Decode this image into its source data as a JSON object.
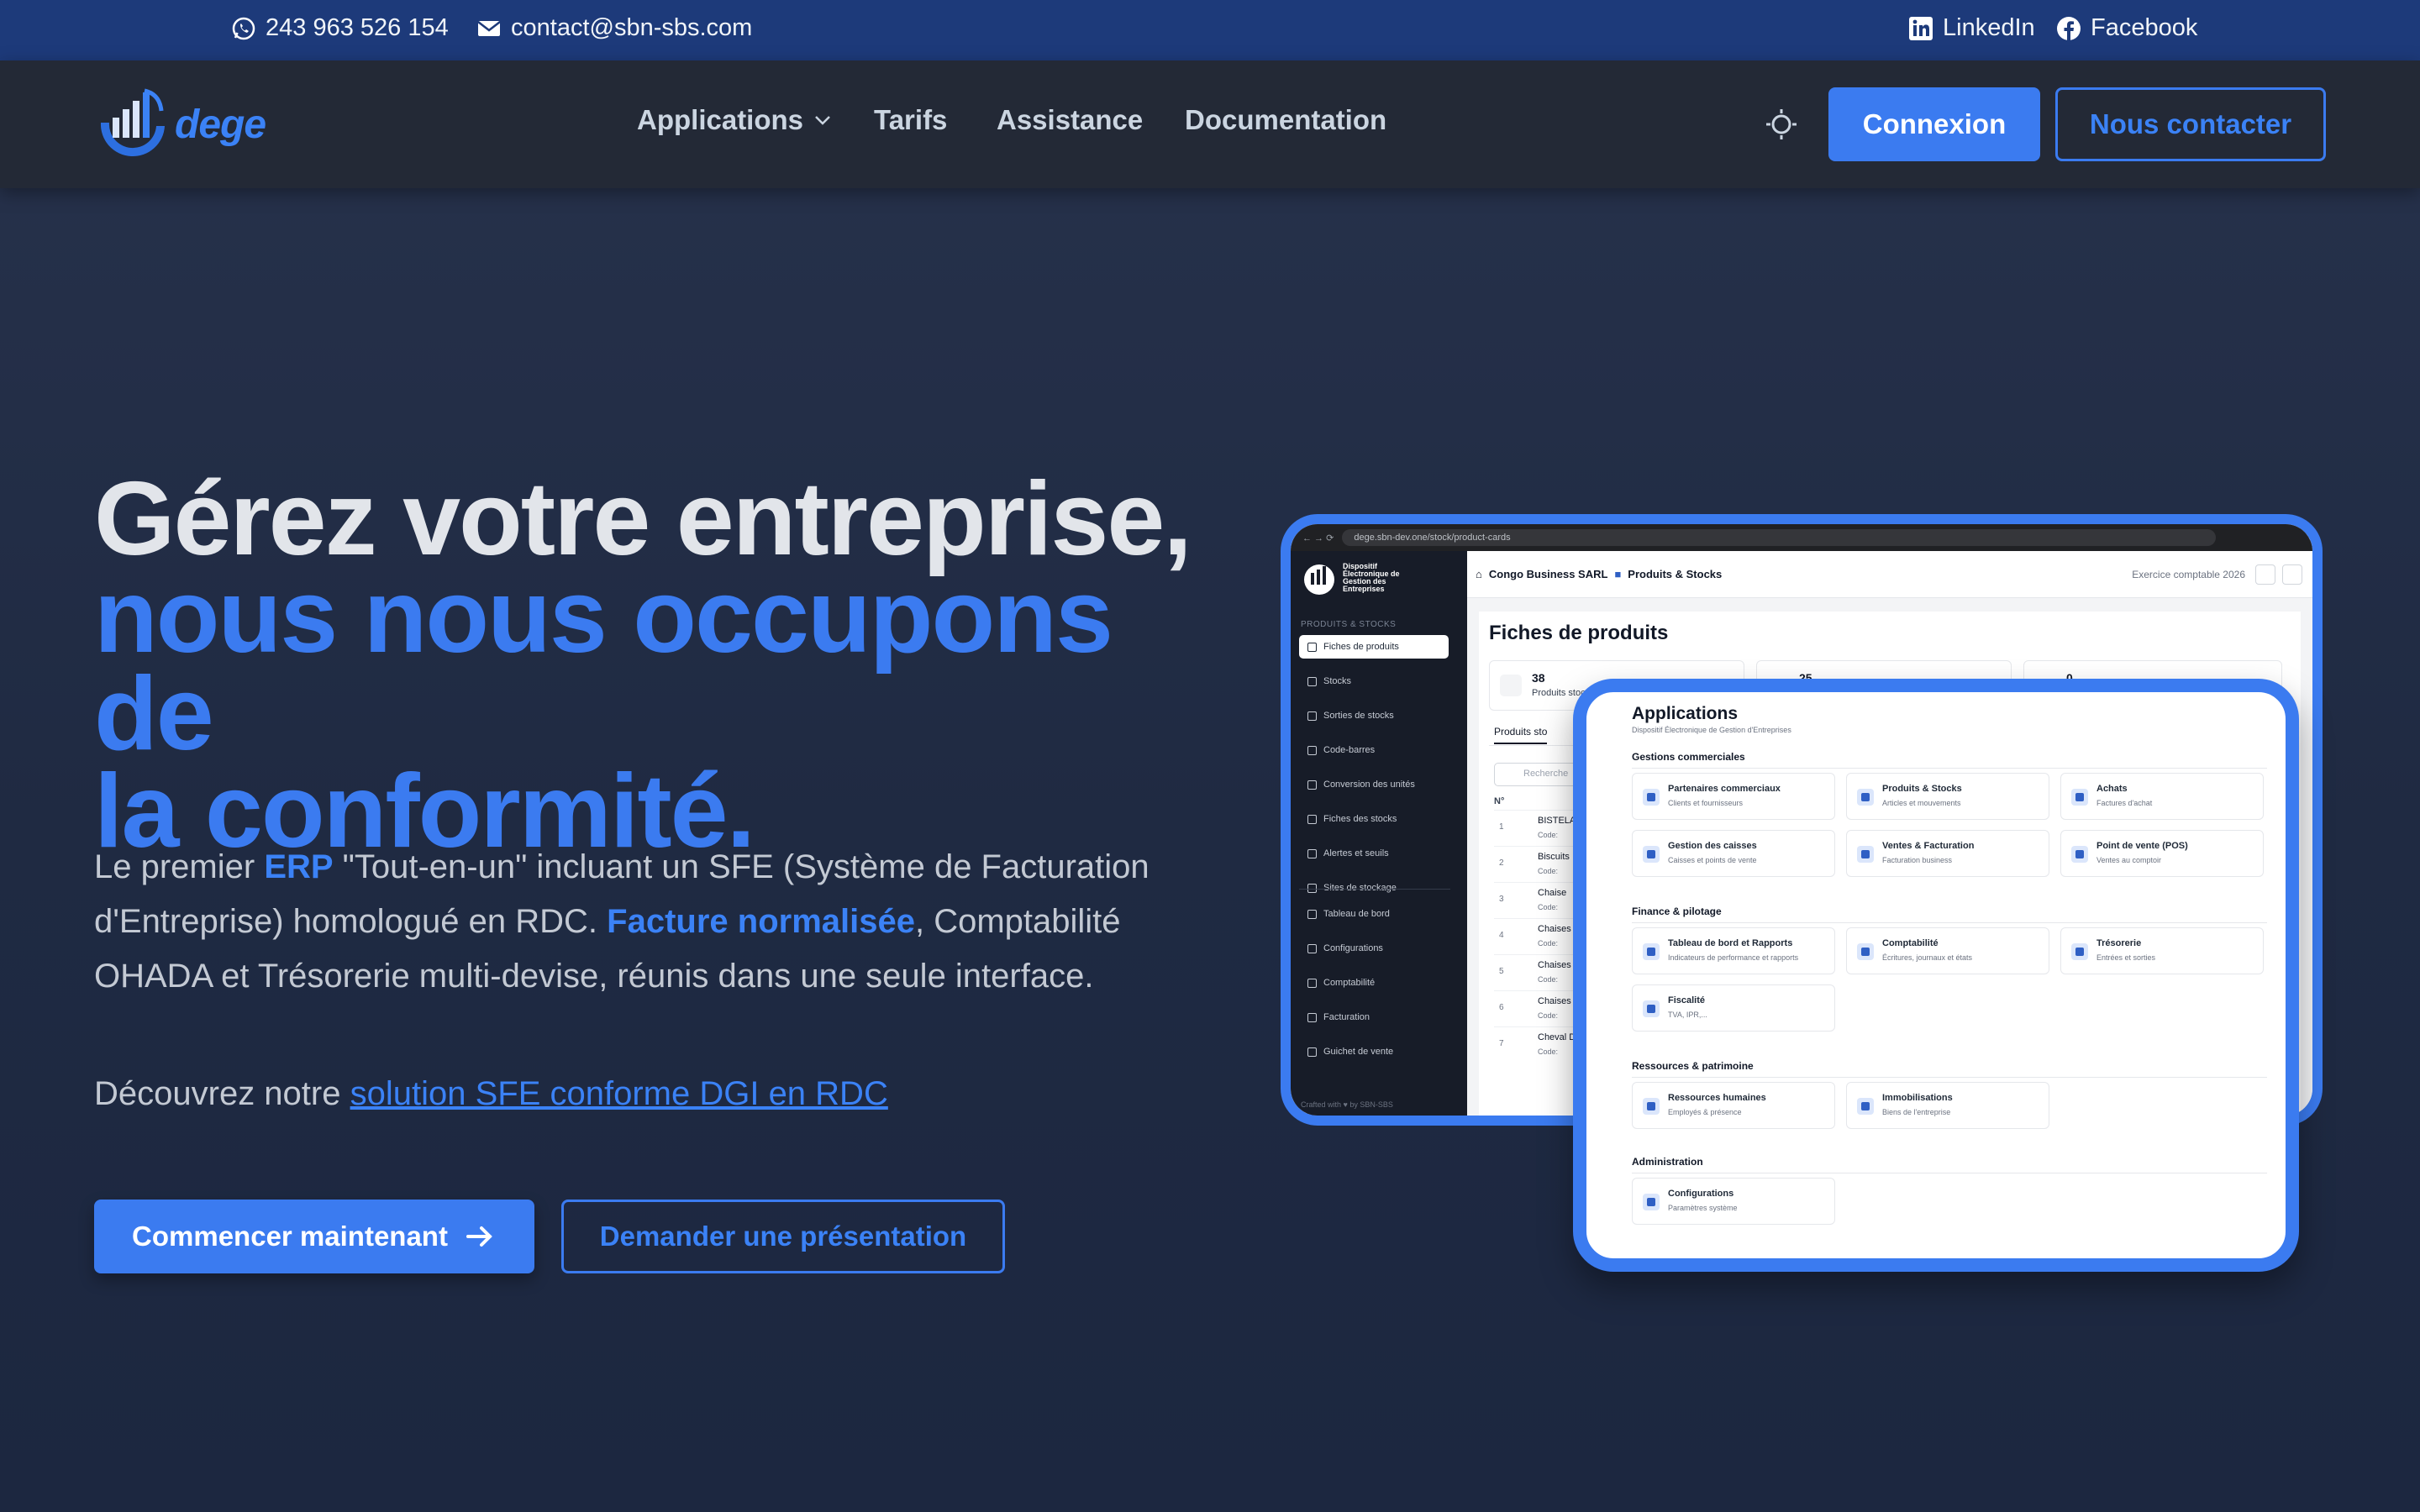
{
  "topbar": {
    "phone": "243 963 526 154",
    "email": "contact@sbn-sbs.com",
    "linkedin": "LinkedIn",
    "facebook": "Facebook",
    "background": "#1d3a7a"
  },
  "nav": {
    "logo_text": "dege",
    "links": {
      "applications": "Applications",
      "tarifs": "Tarifs",
      "assistance": "Assistance",
      "documentation": "Documentation"
    },
    "connexion": "Connexion",
    "contact": "Nous contacter"
  },
  "hero": {
    "title_line1": "Gérez votre entreprise,",
    "title_line2": "nous nous occupons de",
    "title_line3": "la conformité.",
    "desc_part1": "Le premier ",
    "desc_erp": "ERP",
    "desc_part2": " \"Tout-en-un\" incluant un SFE (Système de Facturation d'Entreprise) homologué en RDC. ",
    "desc_facture": "Facture normalisée",
    "desc_part3": ", Comptabilité OHADA et Trésorerie multi-devise, réunis dans une seule interface.",
    "discover_prefix": "Découvrez notre ",
    "discover_link": "solution SFE conforme DGI en RDC",
    "btn_start": "Commencer maintenant",
    "btn_demo": "Demander une présentation"
  },
  "mockup": {
    "url": "dege.sbn-dev.one/stock/product-cards",
    "brand_lines": "Dispositif Électronique de Gestion des Entreprises",
    "company": "Congo Business SARL",
    "module": "Produits & Stocks",
    "exercice": "Exercice comptable 2026",
    "sidebar_section": "PRODUITS & STOCKS",
    "sidebar_items": [
      "Fiches de produits",
      "Stocks",
      "Sorties de stocks",
      "Code-barres",
      "Conversion des unités",
      "Fiches des stocks",
      "Alertes et seuils",
      "Sites de stockage"
    ],
    "sidebar_items2": [
      "Tableau de bord",
      "Configurations",
      "Comptabilité",
      "Facturation",
      "Guichet de vente"
    ],
    "sidebar_footer": "Crafted with ♥ by SBN-SBS",
    "page_title": "Fiches de produits",
    "stat1_num": "38",
    "stat1_label": "Produits stoc",
    "stat2_num": "25",
    "stat3_num": "0",
    "tab_label": "Produits sto",
    "search_placeholder": "Recherche",
    "table_no": "N°",
    "rows": [
      {
        "n": "1",
        "name": "BISTELA",
        "code": "Code:"
      },
      {
        "n": "2",
        "name": "Biscuits",
        "code": "Code:"
      },
      {
        "n": "3",
        "name": "Chaise",
        "code": "Code:"
      },
      {
        "n": "4",
        "name": "Chaises",
        "code": "Code:"
      },
      {
        "n": "5",
        "name": "Chaises",
        "code": "Code:"
      },
      {
        "n": "6",
        "name": "Chaises",
        "code": "Code:"
      },
      {
        "n": "7",
        "name": "Cheval D",
        "code": "Code:"
      }
    ]
  },
  "apps_panel": {
    "title": "Applications",
    "subtitle": "Dispositif Électronique de Gestion d'Entreprises",
    "sections": [
      {
        "label": "Gestions commerciales",
        "cards": [
          {
            "title": "Partenaires commerciaux",
            "sub": "Clients et fournisseurs"
          },
          {
            "title": "Produits & Stocks",
            "sub": "Articles et mouvements"
          },
          {
            "title": "Achats",
            "sub": "Factures d'achat"
          },
          {
            "title": "Gestion des caisses",
            "sub": "Caisses et points de vente"
          },
          {
            "title": "Ventes & Facturation",
            "sub": "Facturation business"
          },
          {
            "title": "Point de vente (POS)",
            "sub": "Ventes au comptoir"
          }
        ]
      },
      {
        "label": "Finance & pilotage",
        "cards": [
          {
            "title": "Tableau de bord et Rapports",
            "sub": "Indicateurs de performance et rapports"
          },
          {
            "title": "Comptabilité",
            "sub": "Écritures, journaux et états"
          },
          {
            "title": "Trésorerie",
            "sub": "Entrées et sorties"
          },
          {
            "title": "Fiscalité",
            "sub": "TVA, IPR,..."
          }
        ]
      },
      {
        "label": "Ressources & patrimoine",
        "cards": [
          {
            "title": "Ressources humaines",
            "sub": "Employés & présence"
          },
          {
            "title": "Immobilisations",
            "sub": "Biens de l'entreprise"
          }
        ]
      },
      {
        "label": "Administration",
        "cards": [
          {
            "title": "Configurations",
            "sub": "Paramètres système"
          }
        ]
      }
    ]
  },
  "colors": {
    "accent": "#3b7bf0",
    "nav_bg": "#232936",
    "page_bg": "#222c45",
    "heading": "#e2e5ea"
  }
}
